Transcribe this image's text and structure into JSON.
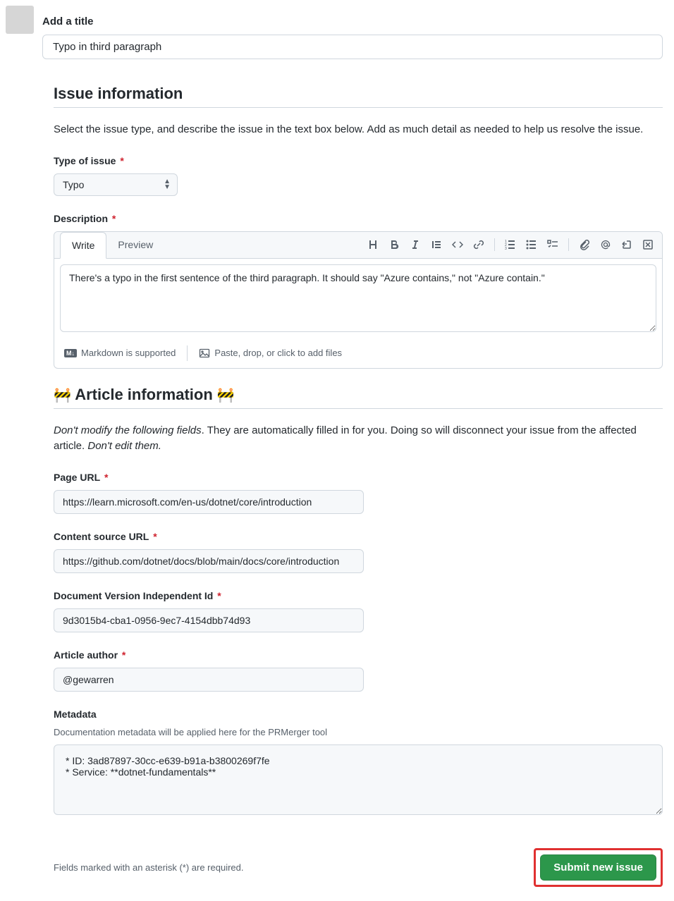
{
  "title_label": "Add a title",
  "title_value": "Typo in third paragraph",
  "issue_info": {
    "heading": "Issue information",
    "description": "Select the issue type, and describe the issue in the text box below. Add as much detail as needed to help us resolve the issue.",
    "type_label": "Type of issue",
    "type_value": "Typo",
    "desc_label": "Description",
    "tabs": {
      "write": "Write",
      "preview": "Preview"
    },
    "desc_value": "There's a typo in the first sentence of the third paragraph. It should say \"Azure contains,\" not \"Azure contain.\"",
    "markdown_hint": "Markdown is supported",
    "attach_hint": "Paste, drop, or click to add files"
  },
  "article_info": {
    "heading": "Article information",
    "warn_lead": "Don't modify the following fields",
    "warn_rest": ". They are automatically filled in for you. Doing so will disconnect your issue from the affected article. ",
    "warn_trail": "Don't edit them.",
    "page_url_label": "Page URL",
    "page_url_value": "https://learn.microsoft.com/en-us/dotnet/core/introduction",
    "content_source_label": "Content source URL",
    "content_source_value": "https://github.com/dotnet/docs/blob/main/docs/core/introduction",
    "doc_id_label": "Document Version Independent Id",
    "doc_id_value": "9d3015b4-cba1-0956-9ec7-4154dbb74d93",
    "author_label": "Article author",
    "author_value": "@gewarren",
    "metadata_label": "Metadata",
    "metadata_help": "Documentation metadata will be applied here for the PRMerger tool",
    "metadata_value": "* ID: 3ad87897-30cc-e639-b91a-b3800269f7fe\n* Service: **dotnet-fundamentals**"
  },
  "footer": {
    "asterisk_note": "Fields marked with an asterisk (*) are required.",
    "submit_label": "Submit new issue"
  }
}
